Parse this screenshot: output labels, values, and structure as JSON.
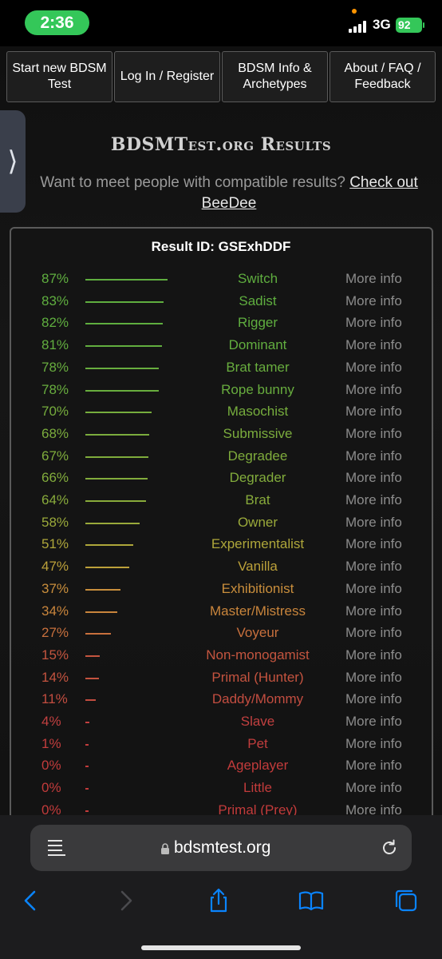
{
  "status": {
    "time": "2:36",
    "network": "3G",
    "battery": "92"
  },
  "nav": [
    {
      "label": "Start new BDSM Test"
    },
    {
      "label": "Log In / Register"
    },
    {
      "label": "BDSM Info & Archetypes"
    },
    {
      "label": "About / FAQ / Feedback"
    }
  ],
  "side_tab": {
    "glyph": "⟩"
  },
  "page_title": "BDSMTest.org Results",
  "promo": {
    "text": "Want to meet people with compatible results? ",
    "link": "Check out BeeDee"
  },
  "result_id": "Result ID: GSExhDDF",
  "more_info_label": "More info",
  "results": [
    {
      "pct": "87%",
      "value": 87,
      "label": "Switch",
      "color": "#5fae3f"
    },
    {
      "pct": "83%",
      "value": 83,
      "label": "Sadist",
      "color": "#5fae3f"
    },
    {
      "pct": "82%",
      "value": 82,
      "label": "Rigger",
      "color": "#5fae3f"
    },
    {
      "pct": "81%",
      "value": 81,
      "label": "Dominant",
      "color": "#62ae3f"
    },
    {
      "pct": "78%",
      "value": 78,
      "label": "Brat tamer",
      "color": "#68ad3e"
    },
    {
      "pct": "78%",
      "value": 78,
      "label": "Rope bunny",
      "color": "#68ad3e"
    },
    {
      "pct": "70%",
      "value": 70,
      "label": "Masochist",
      "color": "#76ad3d"
    },
    {
      "pct": "68%",
      "value": 68,
      "label": "Submissive",
      "color": "#7bac3d"
    },
    {
      "pct": "67%",
      "value": 67,
      "label": "Degradee",
      "color": "#7fac3c"
    },
    {
      "pct": "66%",
      "value": 66,
      "label": "Degrader",
      "color": "#82ac3c"
    },
    {
      "pct": "64%",
      "value": 64,
      "label": "Brat",
      "color": "#88ab3b"
    },
    {
      "pct": "58%",
      "value": 58,
      "label": "Owner",
      "color": "#9aa93a"
    },
    {
      "pct": "51%",
      "value": 51,
      "label": "Experimentalist",
      "color": "#aea63a"
    },
    {
      "pct": "47%",
      "value": 47,
      "label": "Vanilla",
      "color": "#bca13a"
    },
    {
      "pct": "37%",
      "value": 37,
      "label": "Exhibitionist",
      "color": "#c98e3c"
    },
    {
      "pct": "34%",
      "value": 34,
      "label": "Master/Mistress",
      "color": "#c9853c"
    },
    {
      "pct": "27%",
      "value": 27,
      "label": "Voyeur",
      "color": "#c8703d"
    },
    {
      "pct": "15%",
      "value": 15,
      "label": "Non-monogamist",
      "color": "#c4553f"
    },
    {
      "pct": "14%",
      "value": 14,
      "label": "Primal (Hunter)",
      "color": "#c4533f"
    },
    {
      "pct": "11%",
      "value": 11,
      "label": "Daddy/Mommy",
      "color": "#c34d40"
    },
    {
      "pct": "4%",
      "value": 4,
      "label": "Slave",
      "color": "#c24040"
    },
    {
      "pct": "1%",
      "value": 1,
      "label": "Pet",
      "color": "#c23d3d"
    },
    {
      "pct": "0%",
      "value": 0,
      "label": "Ageplayer",
      "color": "#c23b3b"
    },
    {
      "pct": "0%",
      "value": 0,
      "label": "Little",
      "color": "#c23b3b"
    },
    {
      "pct": "0%",
      "value": 0,
      "label": "Primal (Prey)",
      "color": "#c23b3b"
    }
  ],
  "browser": {
    "url": "bdsmtest.org"
  }
}
